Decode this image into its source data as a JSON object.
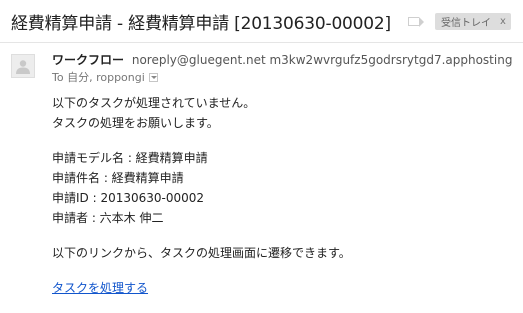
{
  "email": {
    "subject": "経費精算申請 - 経費精算申請 [20130630-00002]",
    "label": "受信トレイ",
    "label_remove": "x",
    "sender": {
      "name": "ワークフロー",
      "email": "noreply@gluegent.net m3kw2wvrgufz5godrsrytgd7.apphosting"
    },
    "recipients": "To 自分, roppongi",
    "body": {
      "intro_line1": "以下のタスクが処理されていません。",
      "intro_line2": "タスクの処理をお願いします。",
      "model_name": "申請モデル名 : 経費精算申請",
      "subject_name": "申請件名 : 経費精算申請",
      "request_id": "申請ID : 20130630-00002",
      "applicant": "申請者 : 六本木 伸二",
      "instruction": "以下のリンクから、タスクの処理画面に遷移できます。",
      "link_text": "タスクを処理する"
    }
  },
  "icons": {
    "importance": "importance-marker-icon",
    "avatar": "default-avatar-icon",
    "details": "chevron-down-icon"
  },
  "colors": {
    "link": "#1155cc",
    "label_chip_bg": "#dddddd",
    "text": "#222222",
    "muted": "#777777"
  }
}
